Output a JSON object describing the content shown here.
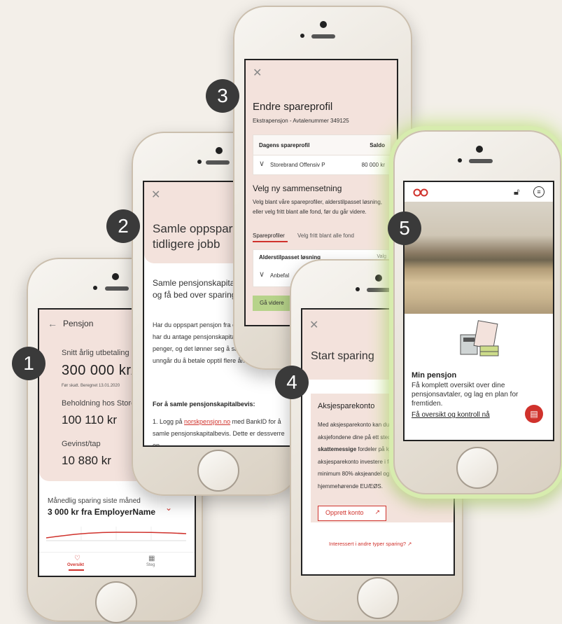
{
  "badges": [
    "1",
    "2",
    "3",
    "4",
    "5"
  ],
  "p1": {
    "back_icon": "arrow-left-icon",
    "header": "Pensjon",
    "avg_label": "Snitt årlig utbetaling",
    "avg_value": "300 000 kr/å",
    "avg_note": "Før skatt. Beregnet 13.01.2020",
    "holding_label": "Beholdning hos Storebra",
    "holding_value": "100 110 kr",
    "gain_label": "Gevinst/tap",
    "gain_value": "10 880 kr",
    "monthly_label": "Månedlig sparing siste måned",
    "monthly_value": "3 000 kr fra EmployerName",
    "tab_overview": "Oversikt",
    "tab_steps": "Steg"
  },
  "p2": {
    "title": "Samle oppspart fra tidligere jobb",
    "lead": "Samle pensjonskapitalb i Storebrand, og få bed over sparingen din.",
    "body": "Har du oppspart pensjon fra en arbeidsgivere? Da har du antage pensjonskapitalbevis. Dette er d penger, og det lønner seg å samle ett sted. Da unngår du å betale opptil flere årlig gebyrer.",
    "howto": "For å samle pensjonskapitalbevis:",
    "step1_pre": "1. Logg på ",
    "step1_link": "norskpensjon.no",
    "step1_post": " med BankID for å samle pensjonskapitalbevis. Dette er dessverre en"
  },
  "p3": {
    "title": "Endre spareprofil",
    "subtitle": "Ekstrapensjon - Avtalenummer 349125",
    "col_profile": "Dagens spareprofil",
    "col_balance": "Saldo",
    "profile_name": "Storebrand Offensiv P",
    "profile_balance": "80 000 kr",
    "new_heading": "Velg ny sammensetning",
    "new_desc": "Velg blant våre spareprofiler, alderstilpasset løsning, eller velg fritt blant alle fond, før du går videre.",
    "tab_profiles": "Spareprofiler",
    "tab_funds": "Velg fritt blant alle fond",
    "section_age": "Alderstilpasset løsning",
    "section_age_right": "Valg",
    "recommended": "Anbefal",
    "continue_btn": "Gå videre"
  },
  "p4": {
    "title": "Start sparing",
    "card_title": "Aksjesparekonto",
    "body_1": "Med aksjesparekonto kan du",
    "body_2": "aksjefondene dine på ett sted",
    "body_3_bold": "skattemessige",
    "body_3_rest": " fordeler på kj",
    "body_4": "aksjesparekonto investere i fo",
    "body_5": "minimum 80% aksjeandel og",
    "body_6": "hjemmehørende EU/EØS.",
    "open_btn": "Opprett konto",
    "other_link": "Interessert i andre typer sparing?"
  },
  "p5": {
    "card_title": "Min pensjon",
    "card_text": "Få komplett oversikt over dine pensjonsavtaler, og lag en plan for fremtiden.",
    "card_link": "Få oversikt og kontroll nå"
  },
  "colors": {
    "accent": "#d0322c",
    "pink": "#f3e2dc",
    "green": "#b7d38a",
    "glow": "#c9e48f"
  }
}
